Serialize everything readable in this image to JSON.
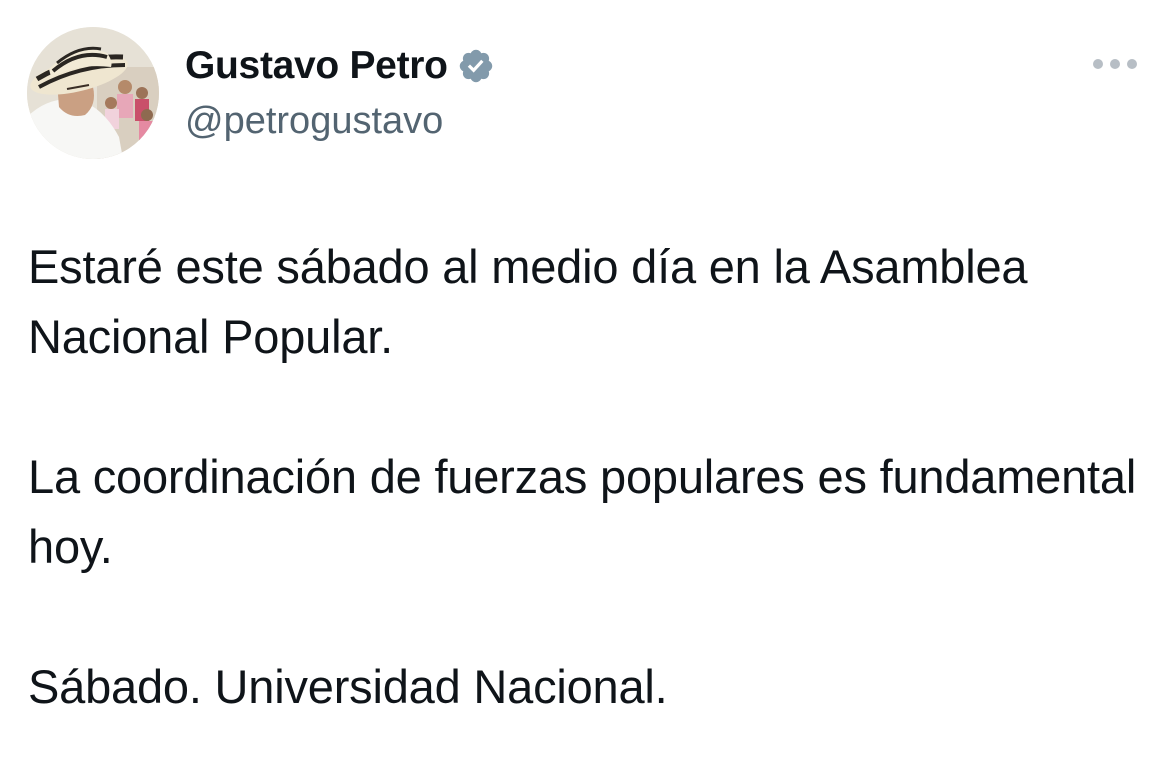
{
  "author": {
    "display_name": "Gustavo Petro",
    "handle": "@petrogustavo",
    "verified": true,
    "verified_color": "#829aab"
  },
  "tweet": {
    "paragraphs": [
      "Estaré este sábado al medio día en la Asamblea Nacional Popular.",
      "La coordinación de fuerzas populares es fundamental hoy.",
      "Sábado. Universidad Nacional."
    ]
  },
  "icons": {
    "more": "more-horizontal-icon",
    "verified": "verified-badge-icon"
  },
  "colors": {
    "text": "#0f1419",
    "secondary_text": "#536471",
    "more_dots": "#b7bec5"
  }
}
